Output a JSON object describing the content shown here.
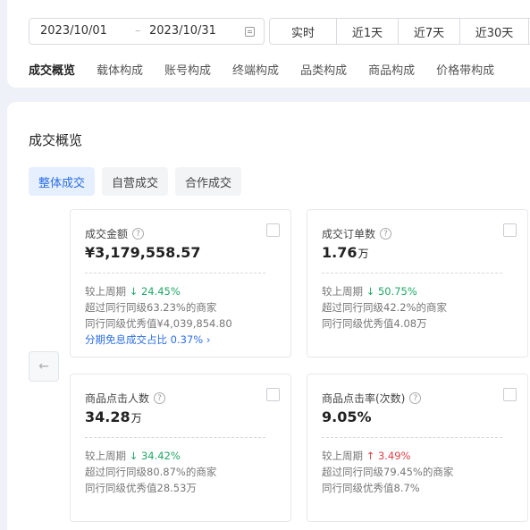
{
  "date_range": {
    "start": "2023/10/01",
    "separator": "–",
    "end": "2023/10/31"
  },
  "quick_ranges": [
    "实时",
    "近1天",
    "近7天",
    "近30天",
    ""
  ],
  "tabs": [
    "成交概览",
    "载体构成",
    "账号构成",
    "终端构成",
    "品类构成",
    "商品构成",
    "价格带构成"
  ],
  "section_title": "成交概览",
  "subtabs": [
    "整体成交",
    "自营成交",
    "合作成交"
  ],
  "nav_prev_icon": "arrow-left-icon",
  "help_glyph": "?",
  "cards": [
    {
      "label": "成交金额",
      "value": "¥3,179,558.57",
      "unit": "",
      "compare_label": "较上周期",
      "compare_arrow": "↓",
      "compare_value": "24.45%",
      "compare_direction": "down",
      "exceed_text": "超过同行同级63.23%的商家",
      "excellent_text": "同行同级优秀值¥4,039,854.80",
      "extra_link": "分期免息成交占比 0.37% ›"
    },
    {
      "label": "成交订单数",
      "value": "1.76",
      "unit": "万",
      "compare_label": "较上周期",
      "compare_arrow": "↓",
      "compare_value": "50.75%",
      "compare_direction": "down",
      "exceed_text": "超过同行同级42.2%的商家",
      "excellent_text": "同行同级优秀值4.08万"
    },
    {
      "label": "商品点击人数",
      "value": "34.28",
      "unit": "万",
      "compare_label": "较上周期",
      "compare_arrow": "↓",
      "compare_value": "34.42%",
      "compare_direction": "down",
      "exceed_text": "超过同行同级80.87%的商家",
      "excellent_text": "同行同级优秀值28.53万"
    },
    {
      "label": "商品点击率(次数)",
      "value": "9.05%",
      "unit": "",
      "compare_label": "较上周期",
      "compare_arrow": "↑",
      "compare_value": "3.49%",
      "compare_direction": "up",
      "exceed_text": "超过同行同级79.45%的商家",
      "excellent_text": "同行同级优秀值8.7%"
    }
  ],
  "colors": {
    "accent": "#2b6ee6",
    "down": "#21a865",
    "up": "#e0414a",
    "background": "#eef1f7"
  }
}
